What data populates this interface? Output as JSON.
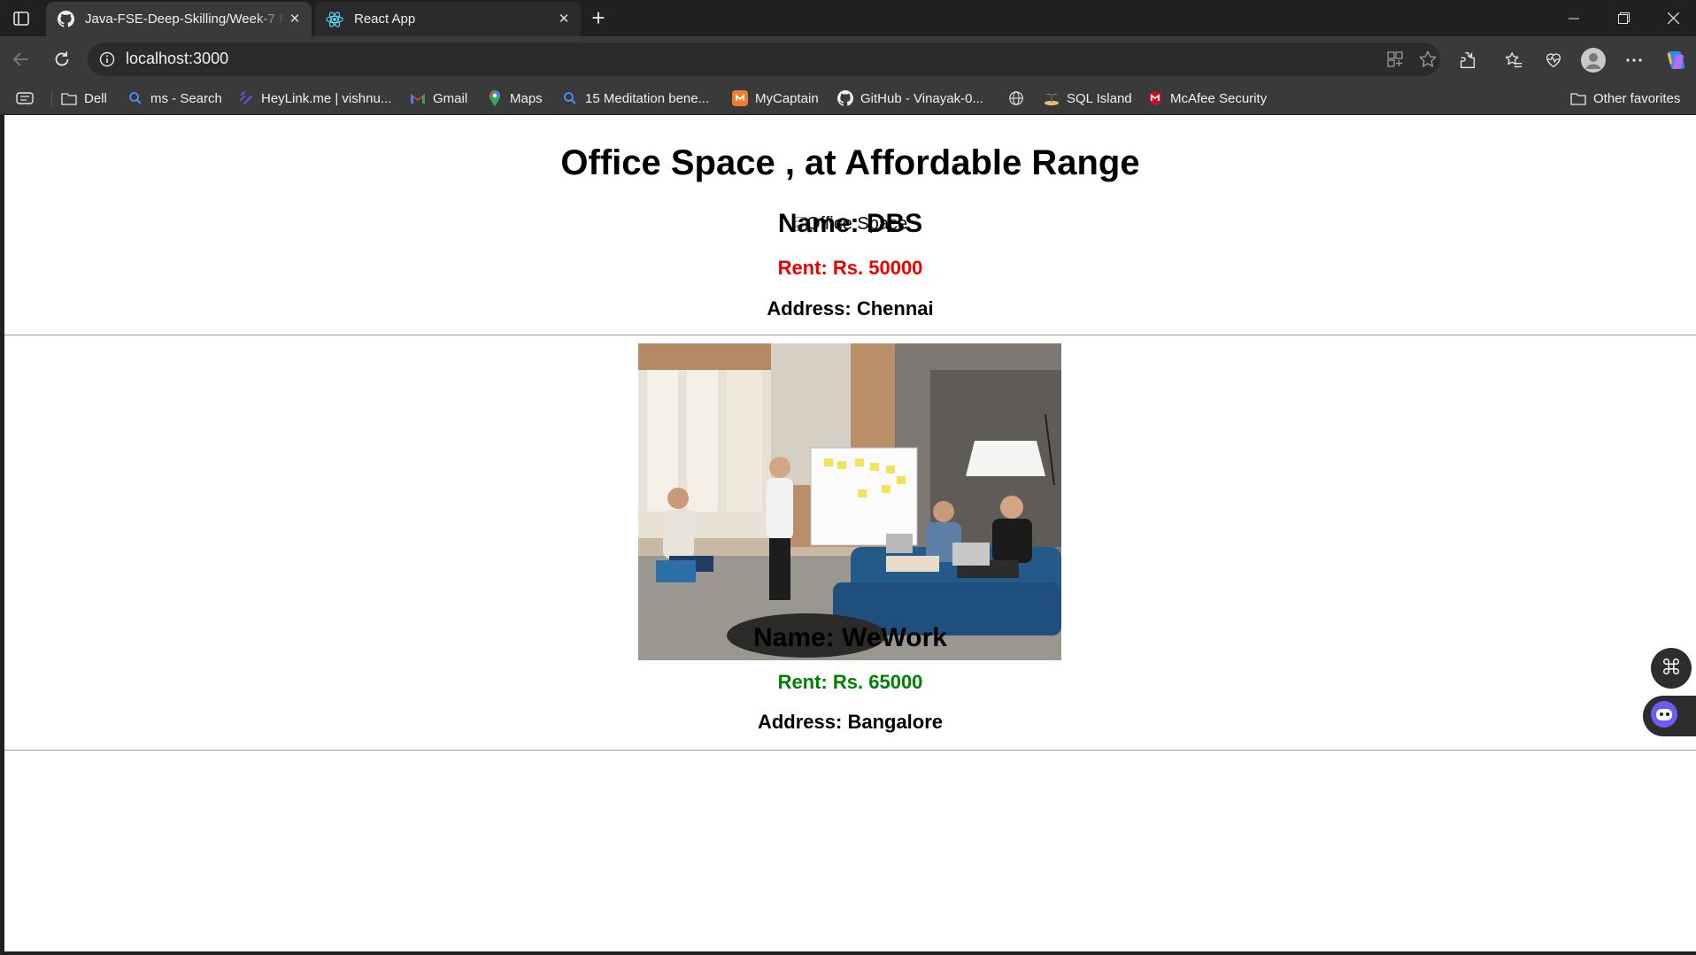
{
  "browser": {
    "tabs": [
      {
        "title": "Java-FSE-Deep-Skilling/Week-7 R",
        "favicon": "github-icon",
        "active": true
      },
      {
        "title": "React App",
        "favicon": "react-icon",
        "active": false
      }
    ],
    "url": "localhost:3000",
    "bookmarks": [
      {
        "label": "Dell",
        "icon": "folder-icon"
      },
      {
        "label": "ms - Search",
        "icon": "search-icon"
      },
      {
        "label": "HeyLink.me | vishnu...",
        "icon": "heylink-icon"
      },
      {
        "label": "Gmail",
        "icon": "gmail-icon"
      },
      {
        "label": "Maps",
        "icon": "maps-icon"
      },
      {
        "label": "15 Meditation bene...",
        "icon": "search-icon"
      },
      {
        "label": "MyCaptain",
        "icon": "mycaptain-icon"
      },
      {
        "label": "GitHub - Vinayak-0...",
        "icon": "github-icon"
      },
      {
        "label": "",
        "icon": "globe-icon"
      },
      {
        "label": "SQL Island",
        "icon": "sql-island-icon"
      },
      {
        "label": "McAfee Security",
        "icon": "mcafee-icon"
      }
    ],
    "other_favorites": "Other favorites"
  },
  "page": {
    "title": "Office Space , at Affordable Range",
    "broken_image_alt": "Office Space",
    "offices": [
      {
        "name": "Name: DBS",
        "rent": "Rent: Rs. 50000",
        "address": "Address: Chennai",
        "rent_color": "#ee0000",
        "image_loaded": false
      },
      {
        "name": "Name: WeWork",
        "rent": "Rent: Rs. 65000",
        "address": "Address: Bangalore",
        "rent_color": "#008000",
        "image_loaded": true
      }
    ]
  },
  "colors": {
    "chrome_dark": "#202020",
    "toolbar": "#3a3a3a",
    "rent_high": "#ee0000",
    "rent_low": "#008000"
  }
}
